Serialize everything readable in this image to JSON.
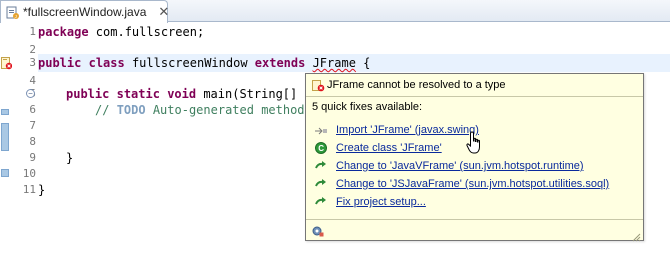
{
  "tab": {
    "label": "*fullscreenWindow.java",
    "icon": "java-file-icon",
    "close_icon": "close-icon"
  },
  "editor": {
    "line_numbers": [
      "1",
      "2",
      "3",
      "4",
      "5",
      "6",
      "7",
      "8",
      "9",
      "10",
      "11"
    ],
    "lines": {
      "l1_kw": "package",
      "l1_rest": " com.fullscreen;",
      "l3_kw1": "public",
      "l3_kw2": "class",
      "l3_name": " fullscreenWindow ",
      "l3_kw3": "extends",
      "l3_sp": " ",
      "l3_err": "JFrame",
      "l3_rest": " {",
      "l5_kw1": "public",
      "l5_kw2": "static",
      "l5_kw3": "void",
      "l5_rest": " main(String[] a",
      "l6_pre": "// ",
      "l6_todo": "TODO",
      "l6_rest": " Auto-generated method",
      "l8": "}",
      "l10": "}"
    }
  },
  "quickfix": {
    "header": "JFrame cannot be resolved to a type",
    "title": "5 quick fixes available:",
    "fixes": [
      {
        "label": "Import 'JFrame' (javax.swing)",
        "icon": "import-icon"
      },
      {
        "label": "Create class 'JFrame'",
        "icon": "create-class-icon"
      },
      {
        "label": "Change to 'JavaVFrame' (sun.jvm.hotspot.runtime)",
        "icon": "change-arrow-icon"
      },
      {
        "label": "Change to 'JSJavaFrame' (sun.jvm.hotspot.utilities.soql)",
        "icon": "change-arrow-icon"
      },
      {
        "label": "Fix project setup...",
        "icon": "change-arrow-icon"
      }
    ]
  },
  "colors": {
    "keyword": "#7f0055",
    "comment": "#3f7f5f",
    "link": "#0a2a9c",
    "hover_bg": "#ffffe1",
    "error": "#e0111b"
  }
}
